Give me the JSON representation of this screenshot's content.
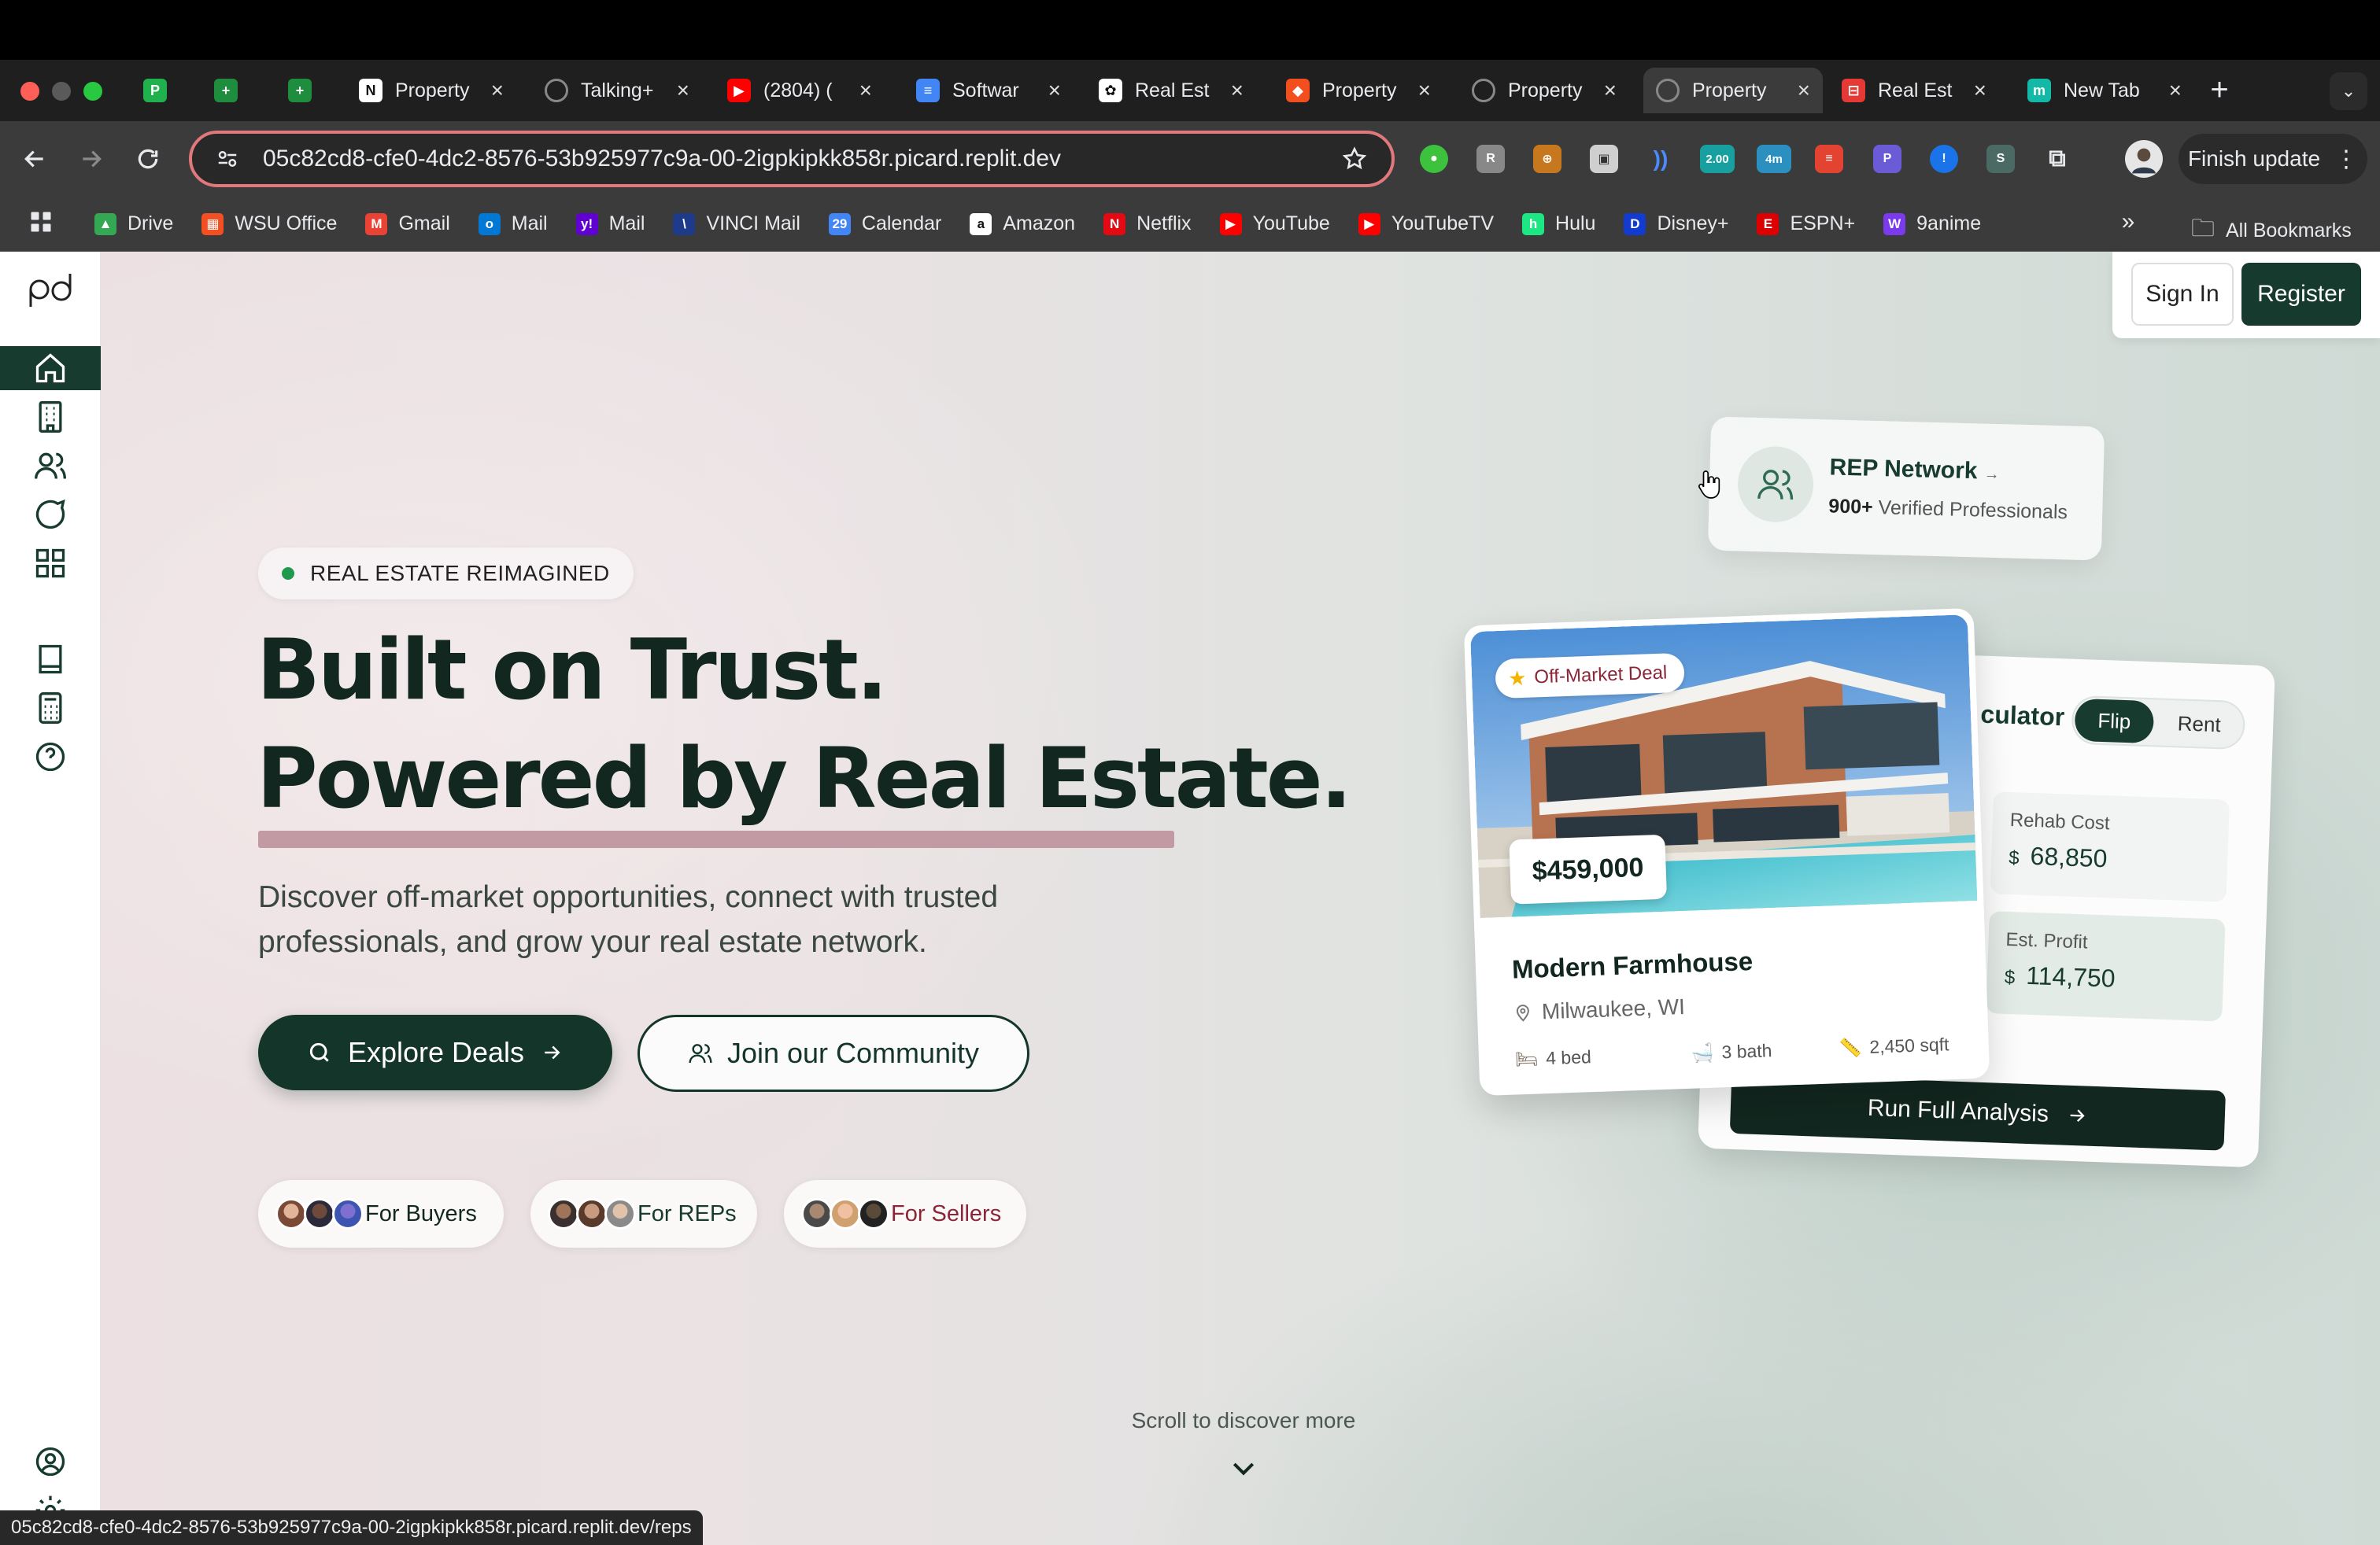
{
  "browser": {
    "tabs": [
      {
        "title": "",
        "icon": "green-p-icon",
        "color": "#20b04e",
        "letter": "P"
      },
      {
        "title": "",
        "icon": "sheets-icon",
        "color": "#1e8e3e",
        "letter": "+"
      },
      {
        "title": "",
        "icon": "sheets-icon",
        "color": "#1e8e3e",
        "letter": "+"
      },
      {
        "title": "Property",
        "icon": "notion-icon",
        "color": "#ffffff",
        "letter": "N"
      },
      {
        "title": "Talking+",
        "icon": "globe-icon",
        "color": "#888888",
        "letter": ""
      },
      {
        "title": "(2804) (",
        "icon": "youtube-icon",
        "color": "#ff0000",
        "letter": "▶"
      },
      {
        "title": "Softwar",
        "icon": "docs-icon",
        "color": "#4285f4",
        "letter": "≡"
      },
      {
        "title": "Real Est",
        "icon": "openai-icon",
        "color": "#ffffff",
        "letter": "✿"
      },
      {
        "title": "Property",
        "icon": "figma-icon",
        "color": "#f24e1e",
        "letter": "◆"
      },
      {
        "title": "Property",
        "icon": "globe-icon",
        "color": "#888888",
        "letter": ""
      },
      {
        "title": "Property",
        "icon": "globe-icon",
        "color": "#888888",
        "letter": ""
      },
      {
        "title": "Real Est",
        "icon": "pdf-icon",
        "color": "#e53935",
        "letter": "⊟"
      },
      {
        "title": "New Tab",
        "icon": "new-tab-icon",
        "color": "#14b8a6",
        "letter": "m"
      }
    ],
    "active_tab_index": 10,
    "new_tab_symbol": "+",
    "url": "05c82cd8-cfe0-4dc2-8576-53b925977c9a-00-2igpkipkk858r.picard.replit.dev",
    "finish_update_label": "Finish update",
    "extensions_badges": [
      "2.00",
      "4m"
    ],
    "bookmarks": [
      {
        "label": "Drive",
        "icon": "drive-icon",
        "color": "#34a853",
        "letter": "▲"
      },
      {
        "label": "WSU Office",
        "icon": "office-icon",
        "color": "#f25022",
        "letter": "▦"
      },
      {
        "label": "Gmail",
        "icon": "gmail-icon",
        "color": "#ea4335",
        "letter": "M"
      },
      {
        "label": "Mail",
        "icon": "outlook-icon",
        "color": "#0078d4",
        "letter": "o"
      },
      {
        "label": "Mail",
        "icon": "yahoo-icon",
        "color": "#6001d2",
        "letter": "y!"
      },
      {
        "label": "VINCI Mail",
        "icon": "vinci-icon",
        "color": "#1e3a8a",
        "letter": "\\"
      },
      {
        "label": "Calendar",
        "icon": "calendar-icon",
        "color": "#4285f4",
        "letter": "29"
      },
      {
        "label": "Amazon",
        "icon": "amazon-icon",
        "color": "#ffffff",
        "letter": "a"
      },
      {
        "label": "Netflix",
        "icon": "netflix-icon",
        "color": "#e50914",
        "letter": "N"
      },
      {
        "label": "YouTube",
        "icon": "youtube-icon",
        "color": "#ff0000",
        "letter": "▶"
      },
      {
        "label": "YouTubeTV",
        "icon": "youtubetv-icon",
        "color": "#ff0000",
        "letter": "▶"
      },
      {
        "label": "Hulu",
        "icon": "hulu-icon",
        "color": "#1ce783",
        "letter": "h"
      },
      {
        "label": "Disney+",
        "icon": "disney-icon",
        "color": "#113ccf",
        "letter": "D"
      },
      {
        "label": "ESPN+",
        "icon": "espn-icon",
        "color": "#d00",
        "letter": "E"
      },
      {
        "label": "9anime",
        "icon": "9anime-icon",
        "color": "#7c3aed",
        "letter": "W"
      }
    ],
    "all_bookmarks_label": "All Bookmarks",
    "status_url": "05c82cd8-cfe0-4dc2-8576-53b925977c9a-00-2igpkipkk858r.picard.replit.dev/reps"
  },
  "app": {
    "logo_text": "pd",
    "sidebar": {
      "items": [
        {
          "name": "home",
          "icon": "home-icon",
          "active": true
        },
        {
          "name": "properties",
          "icon": "building-icon"
        },
        {
          "name": "network",
          "icon": "users-icon"
        },
        {
          "name": "messages",
          "icon": "chat-icon"
        },
        {
          "name": "dashboard",
          "icon": "grid-icon"
        },
        {
          "name": "guides",
          "icon": "book-icon"
        },
        {
          "name": "calculator",
          "icon": "calculator-icon"
        },
        {
          "name": "help",
          "icon": "help-icon"
        },
        {
          "name": "account",
          "icon": "user-circle-icon"
        },
        {
          "name": "settings",
          "icon": "gear-icon"
        }
      ]
    },
    "auth": {
      "sign_in": "Sign In",
      "register": "Register"
    },
    "hero": {
      "badge": "REAL ESTATE REIMAGINED",
      "headline_1": "Built on Trust.",
      "headline_2": "Powered by Real Estate.",
      "subtitle_1": "Discover off-market opportunities, connect with trusted",
      "subtitle_2": "professionals, and grow your real estate network.",
      "explore_button": "Explore Deals",
      "join_button": "Join our Community",
      "personas": [
        {
          "label": "For Buyers",
          "color": "#12271f"
        },
        {
          "label": "For REPs",
          "color": "#173b2e"
        },
        {
          "label": "For Sellers",
          "color": "#8a2638"
        }
      ],
      "scroll_hint": "Scroll to discover more"
    },
    "rep_card": {
      "title": "REP Network",
      "count": "900+",
      "subtitle": "Verified Professionals"
    },
    "calculator_card": {
      "title": "culator",
      "toggle": [
        "Flip",
        "Rent"
      ],
      "rehab_label": "Rehab Cost",
      "rehab_value": "68,850",
      "profit_label": "Est. Profit",
      "profit_value": "114,750",
      "currency": "$",
      "run_button": "Run Full Analysis"
    },
    "property_card": {
      "tag": "Off-Market Deal",
      "price": "$459,000",
      "name": "Modern Farmhouse",
      "location": "Milwaukee, WI",
      "beds": "4 bed",
      "baths": "3 bath",
      "sqft": "2,450 sqft"
    }
  }
}
